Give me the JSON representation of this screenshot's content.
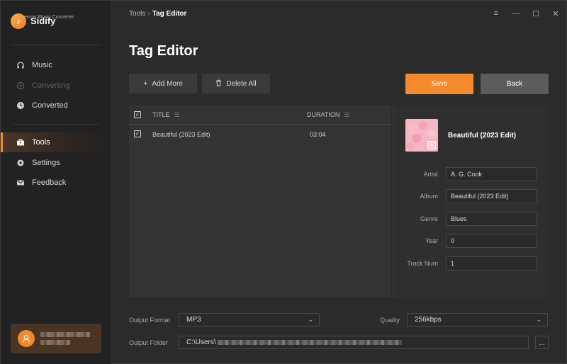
{
  "app": {
    "name": "Sidify",
    "subtitle": "Deezer Music Converter",
    "logo_icon": "music-note-icon",
    "accent_color": "#f48a2c"
  },
  "sidebar": {
    "items": [
      {
        "label": "Music",
        "icon": "headphones-icon",
        "state": "normal"
      },
      {
        "label": "Converting",
        "icon": "sync-icon",
        "state": "disabled"
      },
      {
        "label": "Converted",
        "icon": "clock-icon",
        "state": "normal"
      },
      {
        "label": "Tools",
        "icon": "toolbox-icon",
        "state": "active"
      },
      {
        "label": "Settings",
        "icon": "gear-icon",
        "state": "normal"
      },
      {
        "label": "Feedback",
        "icon": "mail-icon",
        "state": "normal"
      }
    ]
  },
  "header": {
    "breadcrumb_parent": "Tools",
    "breadcrumb_separator": "›",
    "breadcrumb_current": "Tag Editor",
    "window_controls": [
      "menu-icon",
      "minimize-icon",
      "maximize-icon",
      "close-icon"
    ]
  },
  "main": {
    "title": "Tag Editor",
    "toolbar": {
      "add_more_label": "Add More",
      "delete_all_label": "Delete All",
      "save_label": "Save",
      "back_label": "Back"
    },
    "table": {
      "headers": {
        "title": "TITLE",
        "duration": "DURATION"
      },
      "header_checked": true,
      "rows": [
        {
          "title": "Beautiful (2023 Edit)",
          "duration": "03:04",
          "checked": true
        }
      ]
    },
    "details": {
      "track_name": "Beautiful (2023 Edit)",
      "fields": {
        "artist": {
          "label": "Artist",
          "value": "A. G. Cook"
        },
        "album": {
          "label": "Album",
          "value": "Beautiful (2023 Edit)"
        },
        "genre": {
          "label": "Genre",
          "value": "Blues"
        },
        "year": {
          "label": "Year",
          "value": "0"
        },
        "track_num": {
          "label": "Track Num",
          "value": "1"
        }
      }
    },
    "output": {
      "format_label": "Output Format",
      "format_value": "MP3",
      "quality_label": "Quality",
      "quality_value": "256kbps",
      "folder_label": "Output Folder",
      "folder_value_visible": "C:\\Users\\",
      "browse_label": "..."
    }
  }
}
